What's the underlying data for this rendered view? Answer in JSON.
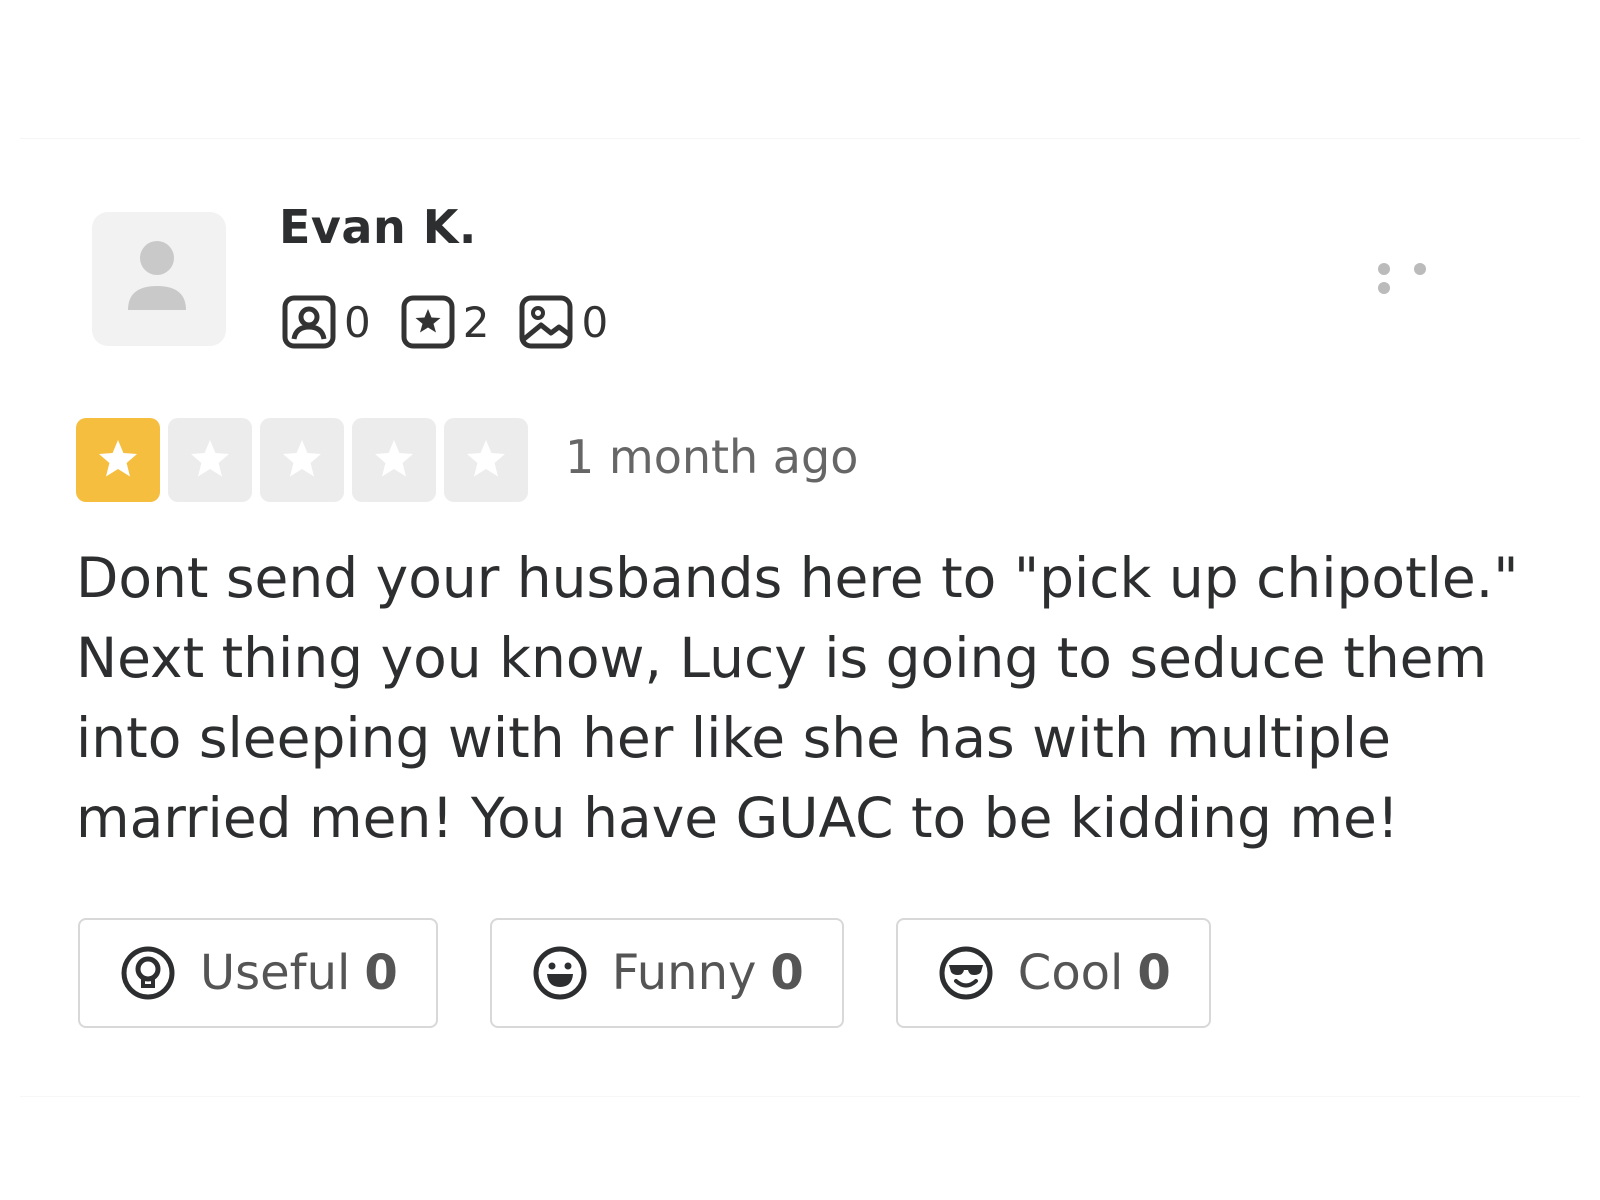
{
  "review": {
    "user": {
      "name": "Evan K.",
      "stats": {
        "friends": "0",
        "reviews": "2",
        "photos": "0"
      }
    },
    "rating": {
      "value": 1,
      "max": 5,
      "filled_color": "#f6be3e",
      "empty_color": "#ececec"
    },
    "time_ago": "1 month ago",
    "text": "Dont send your husbands here to \"pick up chipotle.\" Next thing you know, Lucy is going to seduce them into sleeping with her like she has with multiple married men! You have GUAC to be kidding me!",
    "reactions": {
      "useful": {
        "label": "Useful",
        "count": "0",
        "icon": "lightbulb-icon"
      },
      "funny": {
        "label": "Funny",
        "count": "0",
        "icon": "laugh-face-icon"
      },
      "cool": {
        "label": "Cool",
        "count": "0",
        "icon": "sunglasses-face-icon"
      }
    }
  }
}
